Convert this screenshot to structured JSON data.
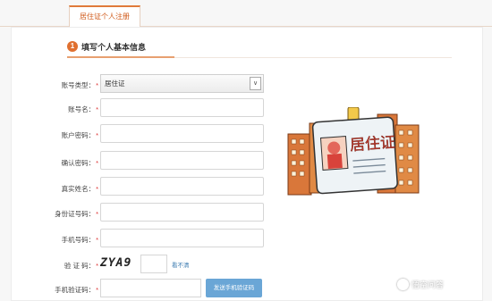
{
  "tab": {
    "label": "居住证个人注册"
  },
  "section": {
    "step": "1",
    "title": "填写个人基本信息"
  },
  "form": {
    "fields": [
      {
        "label": "账号类型：",
        "value": "居住证"
      },
      {
        "label": "账号名：",
        "value": ""
      },
      {
        "label": "账户密码：",
        "value": ""
      },
      {
        "label": "确认密码：",
        "value": ""
      },
      {
        "label": "真实姓名：",
        "value": ""
      },
      {
        "label": "身份证号码：",
        "value": ""
      },
      {
        "label": "手机号码：",
        "value": ""
      },
      {
        "label": "验 证 码：",
        "value": ""
      },
      {
        "label": "手机验证码：",
        "value": ""
      }
    ],
    "required_mark": "*",
    "select_arrow": "∨",
    "captcha_text": "ZYA9",
    "refresh_label": "看不清",
    "sms_button_label": "发送手机验证码"
  },
  "illustration": {
    "card_text": "居住证",
    "icon": "residence-permit-card-illustration"
  },
  "watermark": {
    "text": "悟空问答",
    "icon": "wukong-logo-icon"
  },
  "colors": {
    "accent": "#e07030",
    "tab_text": "#d05a1a",
    "button": "#6aa6d6",
    "link": "#3a7ab0"
  }
}
